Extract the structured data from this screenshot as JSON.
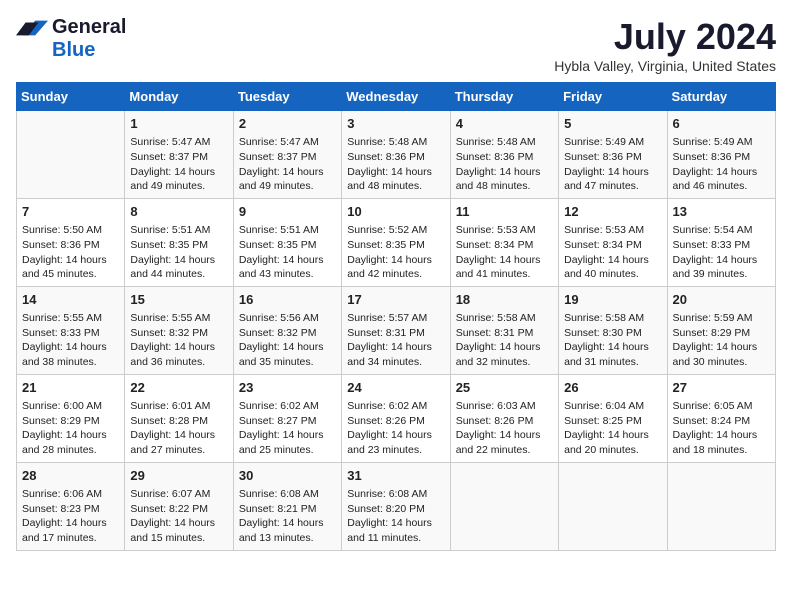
{
  "logo": {
    "general": "General",
    "blue": "Blue"
  },
  "title": "July 2024",
  "subtitle": "Hybla Valley, Virginia, United States",
  "days_of_week": [
    "Sunday",
    "Monday",
    "Tuesday",
    "Wednesday",
    "Thursday",
    "Friday",
    "Saturday"
  ],
  "weeks": [
    [
      {
        "day": "",
        "content": ""
      },
      {
        "day": "1",
        "content": "Sunrise: 5:47 AM\nSunset: 8:37 PM\nDaylight: 14 hours\nand 49 minutes."
      },
      {
        "day": "2",
        "content": "Sunrise: 5:47 AM\nSunset: 8:37 PM\nDaylight: 14 hours\nand 49 minutes."
      },
      {
        "day": "3",
        "content": "Sunrise: 5:48 AM\nSunset: 8:36 PM\nDaylight: 14 hours\nand 48 minutes."
      },
      {
        "day": "4",
        "content": "Sunrise: 5:48 AM\nSunset: 8:36 PM\nDaylight: 14 hours\nand 48 minutes."
      },
      {
        "day": "5",
        "content": "Sunrise: 5:49 AM\nSunset: 8:36 PM\nDaylight: 14 hours\nand 47 minutes."
      },
      {
        "day": "6",
        "content": "Sunrise: 5:49 AM\nSunset: 8:36 PM\nDaylight: 14 hours\nand 46 minutes."
      }
    ],
    [
      {
        "day": "7",
        "content": "Sunrise: 5:50 AM\nSunset: 8:36 PM\nDaylight: 14 hours\nand 45 minutes."
      },
      {
        "day": "8",
        "content": "Sunrise: 5:51 AM\nSunset: 8:35 PM\nDaylight: 14 hours\nand 44 minutes."
      },
      {
        "day": "9",
        "content": "Sunrise: 5:51 AM\nSunset: 8:35 PM\nDaylight: 14 hours\nand 43 minutes."
      },
      {
        "day": "10",
        "content": "Sunrise: 5:52 AM\nSunset: 8:35 PM\nDaylight: 14 hours\nand 42 minutes."
      },
      {
        "day": "11",
        "content": "Sunrise: 5:53 AM\nSunset: 8:34 PM\nDaylight: 14 hours\nand 41 minutes."
      },
      {
        "day": "12",
        "content": "Sunrise: 5:53 AM\nSunset: 8:34 PM\nDaylight: 14 hours\nand 40 minutes."
      },
      {
        "day": "13",
        "content": "Sunrise: 5:54 AM\nSunset: 8:33 PM\nDaylight: 14 hours\nand 39 minutes."
      }
    ],
    [
      {
        "day": "14",
        "content": "Sunrise: 5:55 AM\nSunset: 8:33 PM\nDaylight: 14 hours\nand 38 minutes."
      },
      {
        "day": "15",
        "content": "Sunrise: 5:55 AM\nSunset: 8:32 PM\nDaylight: 14 hours\nand 36 minutes."
      },
      {
        "day": "16",
        "content": "Sunrise: 5:56 AM\nSunset: 8:32 PM\nDaylight: 14 hours\nand 35 minutes."
      },
      {
        "day": "17",
        "content": "Sunrise: 5:57 AM\nSunset: 8:31 PM\nDaylight: 14 hours\nand 34 minutes."
      },
      {
        "day": "18",
        "content": "Sunrise: 5:58 AM\nSunset: 8:31 PM\nDaylight: 14 hours\nand 32 minutes."
      },
      {
        "day": "19",
        "content": "Sunrise: 5:58 AM\nSunset: 8:30 PM\nDaylight: 14 hours\nand 31 minutes."
      },
      {
        "day": "20",
        "content": "Sunrise: 5:59 AM\nSunset: 8:29 PM\nDaylight: 14 hours\nand 30 minutes."
      }
    ],
    [
      {
        "day": "21",
        "content": "Sunrise: 6:00 AM\nSunset: 8:29 PM\nDaylight: 14 hours\nand 28 minutes."
      },
      {
        "day": "22",
        "content": "Sunrise: 6:01 AM\nSunset: 8:28 PM\nDaylight: 14 hours\nand 27 minutes."
      },
      {
        "day": "23",
        "content": "Sunrise: 6:02 AM\nSunset: 8:27 PM\nDaylight: 14 hours\nand 25 minutes."
      },
      {
        "day": "24",
        "content": "Sunrise: 6:02 AM\nSunset: 8:26 PM\nDaylight: 14 hours\nand 23 minutes."
      },
      {
        "day": "25",
        "content": "Sunrise: 6:03 AM\nSunset: 8:26 PM\nDaylight: 14 hours\nand 22 minutes."
      },
      {
        "day": "26",
        "content": "Sunrise: 6:04 AM\nSunset: 8:25 PM\nDaylight: 14 hours\nand 20 minutes."
      },
      {
        "day": "27",
        "content": "Sunrise: 6:05 AM\nSunset: 8:24 PM\nDaylight: 14 hours\nand 18 minutes."
      }
    ],
    [
      {
        "day": "28",
        "content": "Sunrise: 6:06 AM\nSunset: 8:23 PM\nDaylight: 14 hours\nand 17 minutes."
      },
      {
        "day": "29",
        "content": "Sunrise: 6:07 AM\nSunset: 8:22 PM\nDaylight: 14 hours\nand 15 minutes."
      },
      {
        "day": "30",
        "content": "Sunrise: 6:08 AM\nSunset: 8:21 PM\nDaylight: 14 hours\nand 13 minutes."
      },
      {
        "day": "31",
        "content": "Sunrise: 6:08 AM\nSunset: 8:20 PM\nDaylight: 14 hours\nand 11 minutes."
      },
      {
        "day": "",
        "content": ""
      },
      {
        "day": "",
        "content": ""
      },
      {
        "day": "",
        "content": ""
      }
    ]
  ]
}
